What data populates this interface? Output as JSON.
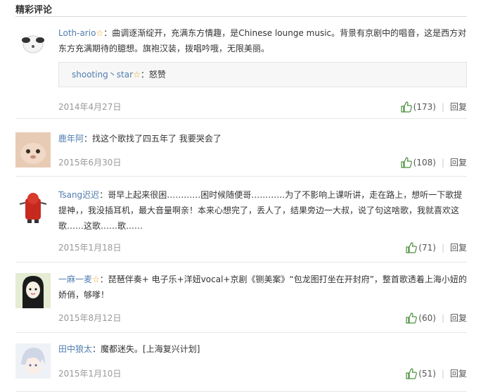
{
  "section": {
    "title": "精彩评论"
  },
  "comments": [
    {
      "user": "Loth-ario",
      "text": "：曲调逐渐绽开，充满东方情趣，是Chinese lounge music。背景有京剧中的唱音，这是西方对东方充满期待的臆想。旗袍汉装，拨唱吟哦，无限美丽。",
      "reply": {
        "user": "shooting丶star",
        "text": "：怒赞"
      },
      "date": "2014年4月27日",
      "likes": "(173)",
      "reply_label": "回复"
    },
    {
      "user": "鹿年阿",
      "text": "：找这个歌找了四五年了 我要哭会了",
      "date": "2015年6月30日",
      "likes": "(108)",
      "reply_label": "回复"
    },
    {
      "user": "Tsang迟迟",
      "text": "：哥早上起来很困…………困时候随便哥…………为了不影响上课听讲，走在路上，想听一下歌提提神，，我没插耳机，最大音量啊亲！本来心想完了，丢人了，结果旁边一大叔，说了句这啥歌，我就喜欢这歌……这歌……歌……",
      "date": "2015年1月18日",
      "likes": "(71)",
      "reply_label": "回复"
    },
    {
      "user": "一麻一麦",
      "text": "：琵琶伴奏+ 电子乐+洋妞vocal+京剧《铡美案》“包龙图打坐在开封府”，整首歌透着上海小妞的娇俏，够嗲！",
      "date": "2015年8月12日",
      "likes": "(60)",
      "reply_label": "回复"
    },
    {
      "user": "田中狼太",
      "text": "：魔都迷失。[上海复兴计划]",
      "date": "2015年1月10日",
      "likes": "(51)",
      "reply_label": "回复"
    }
  ]
}
